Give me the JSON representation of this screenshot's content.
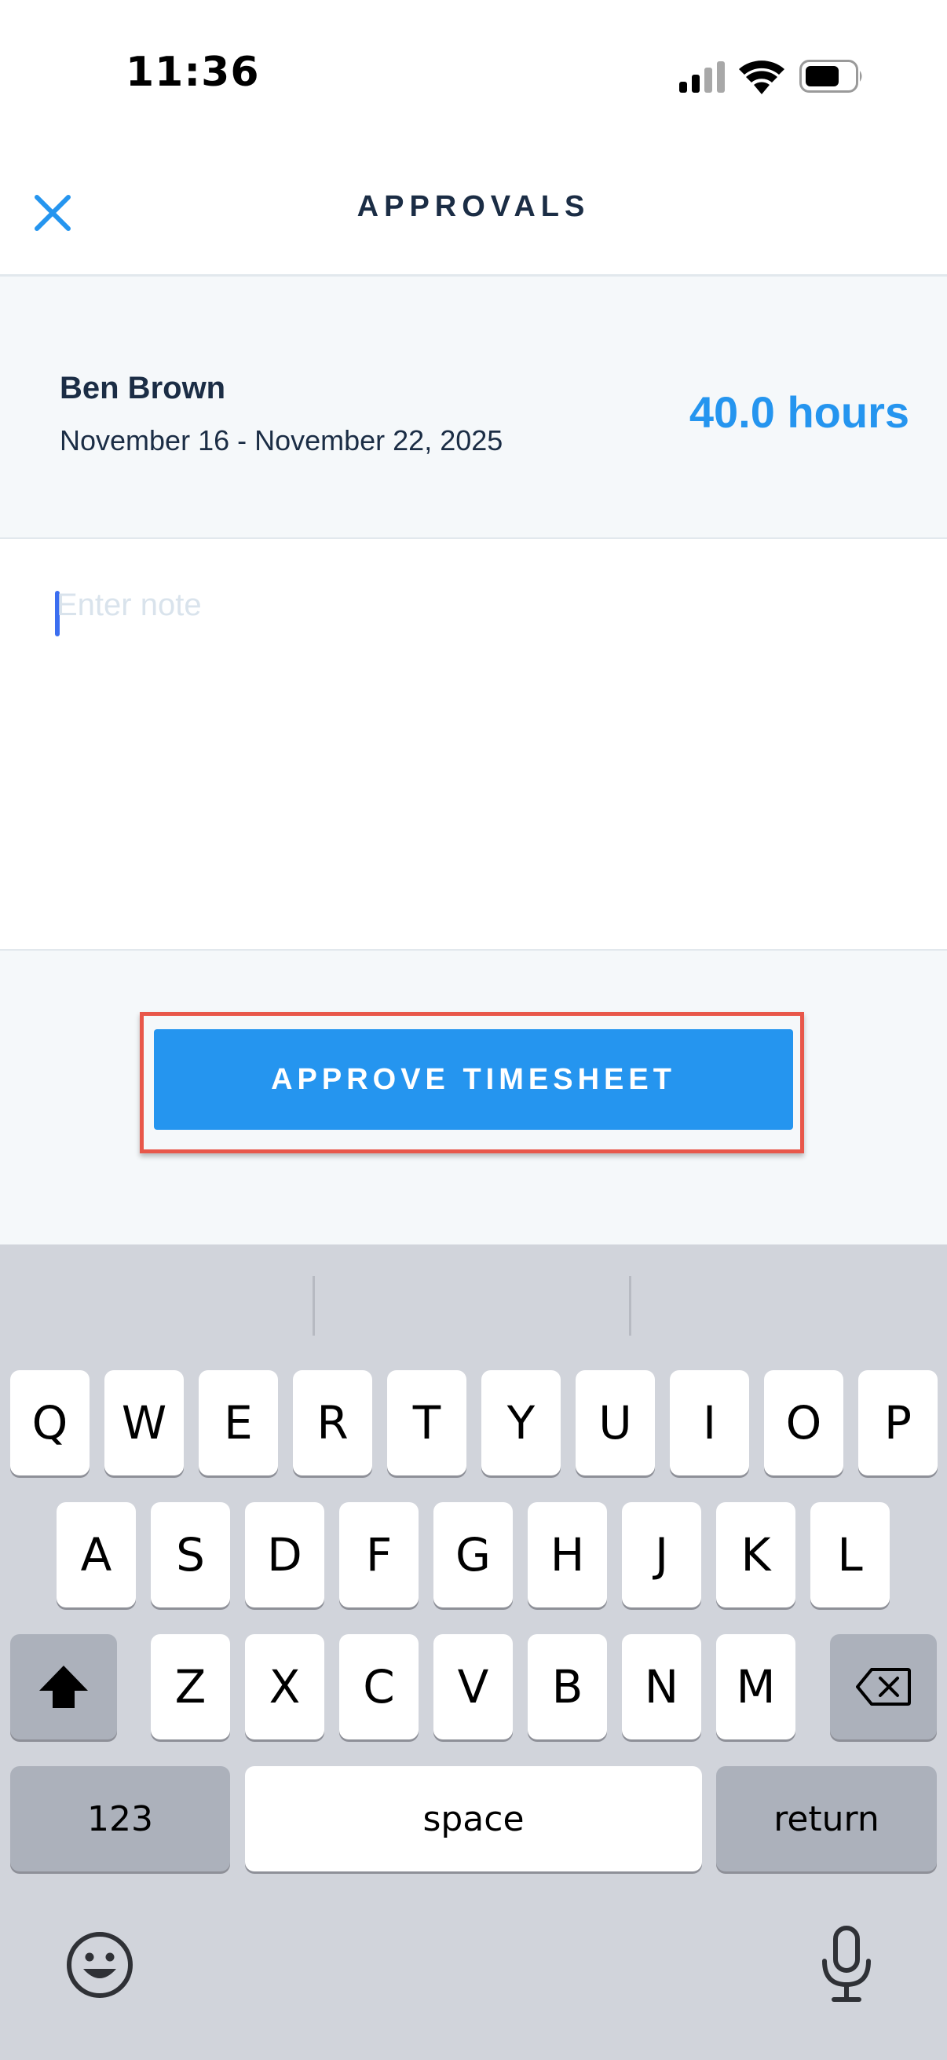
{
  "status_bar": {
    "time": "11:36"
  },
  "header": {
    "title": "APPROVALS",
    "close_icon": "close-icon"
  },
  "summary": {
    "employee_name": "Ben Brown",
    "date_range": "November 16 - November 22, 2025",
    "hours": "40.0 hours"
  },
  "note": {
    "placeholder": "Enter note",
    "value": ""
  },
  "actions": {
    "approve_label": "APPROVE TIMESHEET"
  },
  "keyboard": {
    "row1": [
      "Q",
      "W",
      "E",
      "R",
      "T",
      "Y",
      "U",
      "I",
      "O",
      "P"
    ],
    "row2": [
      "A",
      "S",
      "D",
      "F",
      "G",
      "H",
      "J",
      "K",
      "L"
    ],
    "row3": [
      "Z",
      "X",
      "C",
      "V",
      "B",
      "N",
      "M"
    ],
    "numbers_label": "123",
    "space_label": "space",
    "return_label": "return",
    "shift_icon": "shift-icon",
    "delete_icon": "delete-icon",
    "emoji_icon": "emoji-icon",
    "mic_icon": "microphone-icon"
  },
  "colors": {
    "accent": "#2595EF",
    "title_text": "#1B2D45",
    "highlight": "#E8574A",
    "keyboard_bg": "#D1D4DB"
  }
}
